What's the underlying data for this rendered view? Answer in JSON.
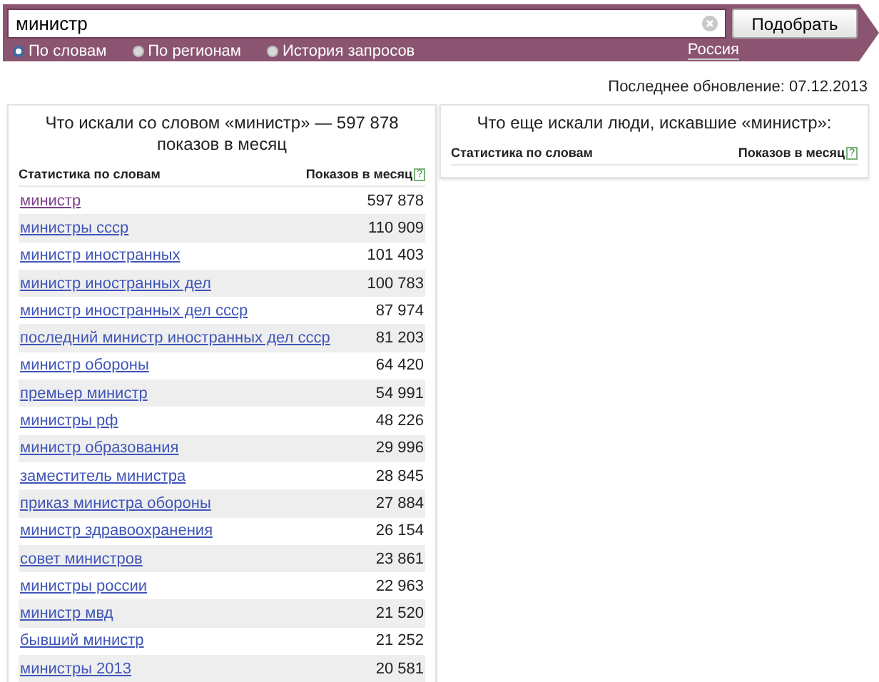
{
  "search": {
    "value": "министр",
    "button": "Подобрать",
    "modes": [
      {
        "label": "По словам",
        "selected": true
      },
      {
        "label": "По регионам",
        "selected": false
      },
      {
        "label": "История запросов",
        "selected": false
      }
    ],
    "region": "Россия"
  },
  "last_update": "Последнее обновление: 07.12.2013",
  "panels": [
    {
      "title": "Что искали со словом «министр» — 597 878 показов в месяц",
      "columns": [
        {
          "label": "Статистика по словам"
        },
        {
          "label": "Показов в месяц",
          "hint": "?"
        }
      ],
      "rows": [
        {
          "phrase": "министр",
          "count": "597 878",
          "visited": true
        },
        {
          "phrase": "министры ссср",
          "count": "110 909",
          "visited": false
        },
        {
          "phrase": "министр иностранных",
          "count": "101 403",
          "visited": false
        },
        {
          "phrase": "министр иностранных дел",
          "count": "100 783",
          "visited": false
        },
        {
          "phrase": "министр иностранных дел ссср",
          "count": "87 974",
          "visited": false
        },
        {
          "phrase": "последний министр иностранных дел ссср",
          "count": "81 203",
          "visited": false
        },
        {
          "phrase": "министр обороны",
          "count": "64 420",
          "visited": false
        },
        {
          "phrase": "премьер министр",
          "count": "54 991",
          "visited": false
        },
        {
          "phrase": "министры рф",
          "count": "48 226",
          "visited": false
        },
        {
          "phrase": "министр образования",
          "count": "29 996",
          "visited": false
        },
        {
          "phrase": "заместитель министра",
          "count": "28 845",
          "visited": false
        },
        {
          "phrase": "приказ министра обороны",
          "count": "27 884",
          "visited": false
        },
        {
          "phrase": "министр здравоохранения",
          "count": "26 154",
          "visited": false
        },
        {
          "phrase": "совет министров",
          "count": "23 861",
          "visited": false
        },
        {
          "phrase": "министры россии",
          "count": "22 963",
          "visited": false
        },
        {
          "phrase": "министр мвд",
          "count": "21 520",
          "visited": false
        },
        {
          "phrase": "бывший министр",
          "count": "21 252",
          "visited": false
        },
        {
          "phrase": "министры 2013",
          "count": "20 581",
          "visited": false
        }
      ]
    },
    {
      "title": "Что еще искали люди, искавшие «министр»:",
      "columns": [
        {
          "label": "Статистика по словам"
        },
        {
          "label": "Показов в месяц",
          "hint": "?"
        }
      ]
    }
  ]
}
